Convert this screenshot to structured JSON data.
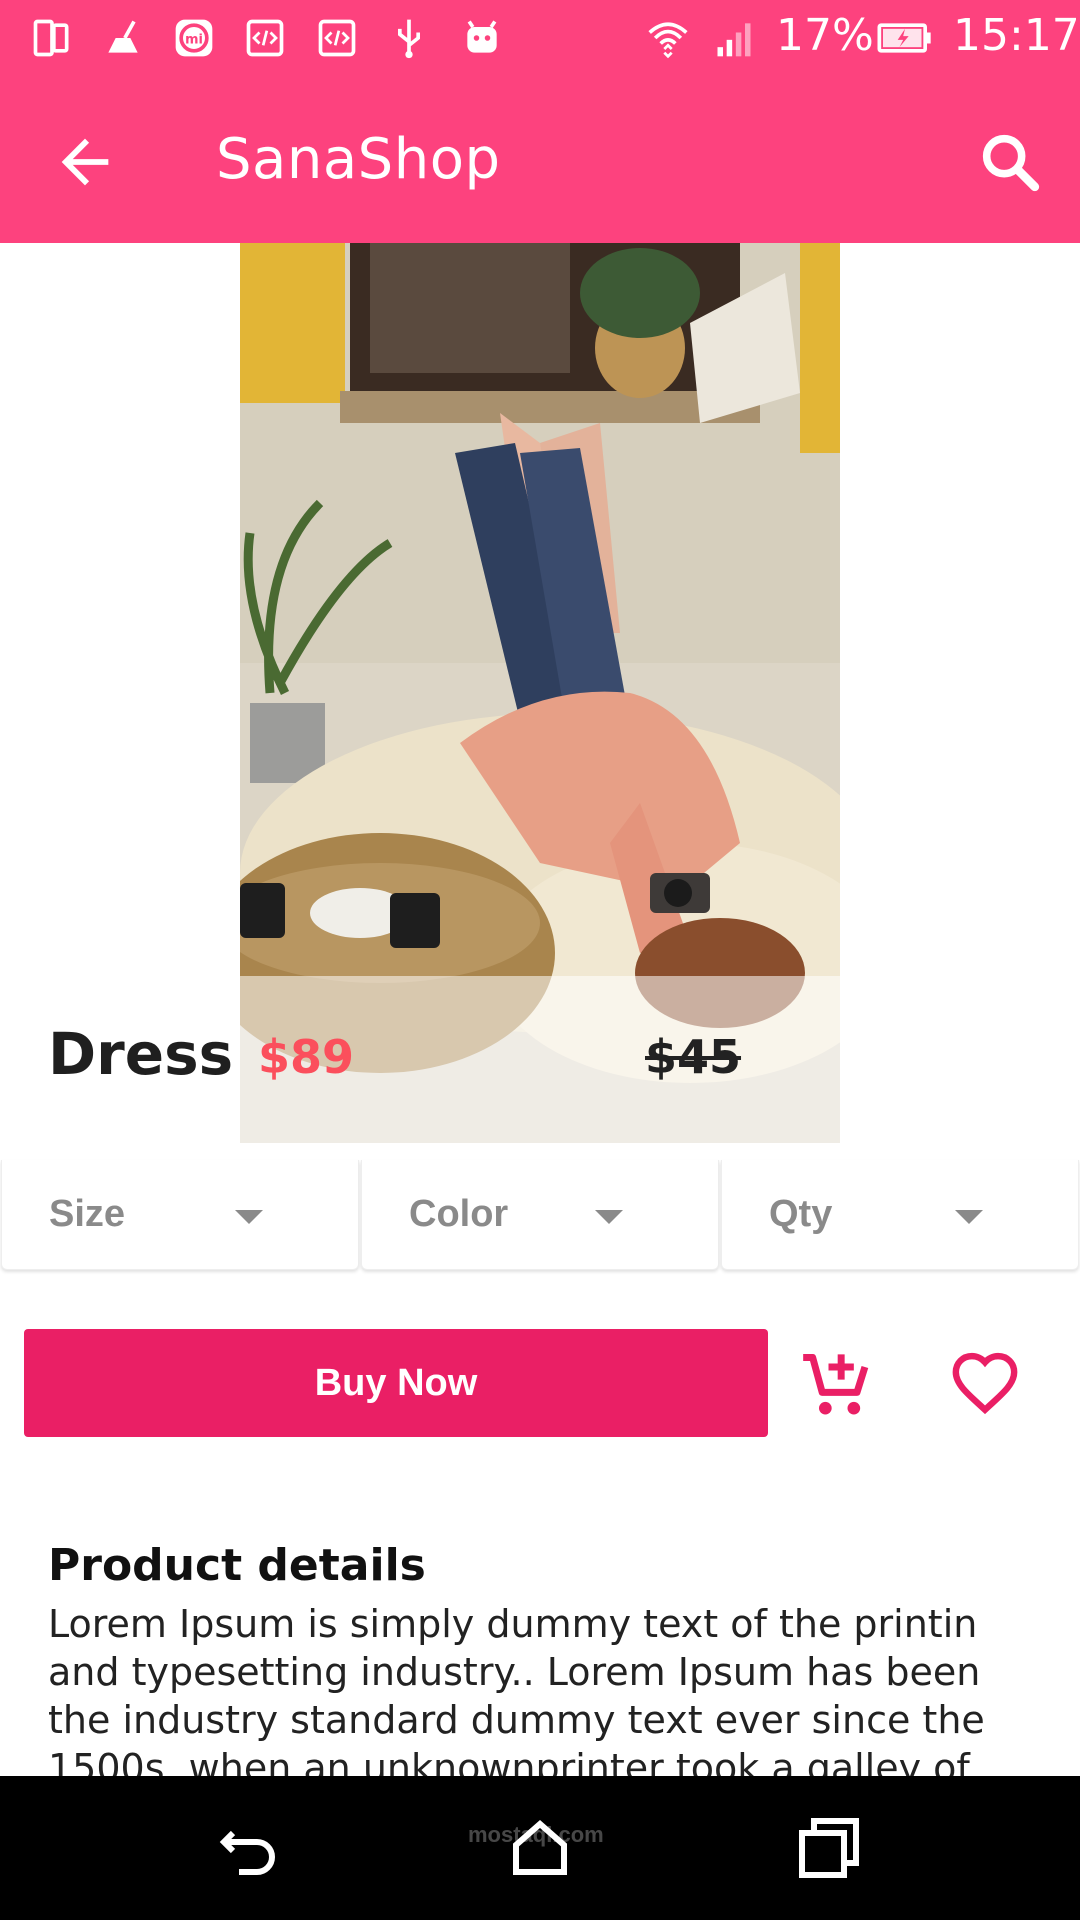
{
  "status_bar": {
    "battery": "17%",
    "time": "15:17",
    "icons": [
      "tablet-icon",
      "broom-icon",
      "mi-icon",
      "code-icon",
      "code-icon",
      "usb-icon",
      "android-icon",
      "wifi-icon",
      "signal-icon",
      "battery-charging-icon"
    ]
  },
  "app_bar": {
    "title": "SanaShop",
    "back_icon": "arrow-back-icon",
    "search_icon": "search-icon"
  },
  "product": {
    "name": "Dress",
    "sale_price": "$89",
    "original_price": "$45"
  },
  "selectors": [
    {
      "label": "Size"
    },
    {
      "label": "Color"
    },
    {
      "label": "Qty"
    }
  ],
  "actions": {
    "buy_label": "Buy Now",
    "cart_icon": "add-to-cart-icon",
    "favorite_icon": "heart-icon"
  },
  "details": {
    "title": "Product details",
    "body": "Lorem Ipsum is simply dummy text of the printin and typesetting industry.. Lorem Ipsum has been the industry standard dummy text ever since the 1500s, when an unknownprinter took a galley of"
  },
  "nav_bar": {
    "icons": [
      "back-nav-icon",
      "home-nav-icon",
      "recents-nav-icon"
    ],
    "watermark": "mostaql.com"
  },
  "colors": {
    "primary": "#fd427e",
    "accent": "#ea1f65",
    "sale_price": "#fb4f5c"
  }
}
